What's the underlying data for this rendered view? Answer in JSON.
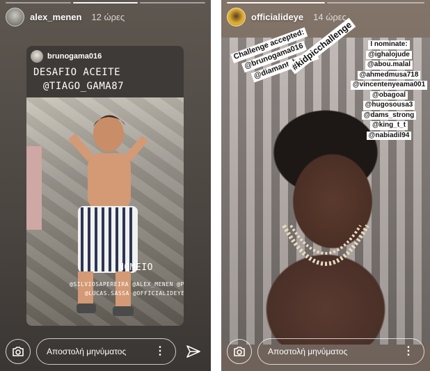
{
  "left": {
    "username": "alex_menen",
    "time": "12 ώρες",
    "reshare": {
      "username": "brunogama016",
      "title": "DESAFIO ACEITE",
      "tag": "@TIAGO_GAMA87",
      "nominate_label": "NOMEIO",
      "nominees_line1": "@SILVIOSAPEREIRA @ALEX_MENEN @PIZZI21",
      "nominees_line2": "@LUCAS.SASSA @OFFICIALIDEYE"
    },
    "message_placeholder": "Αποστολή μηνύματος",
    "more": "⋮",
    "send_icon": "send-icon"
  },
  "right": {
    "username": "officialideye",
    "time": "14 ώρες",
    "challenge_line1": "Challenge accepted:",
    "challenge_line2": "@brunogama016",
    "challenge_line3": "@diamant_barber",
    "hashtag": "#kidpicchallenge",
    "nominate_title": "I nominate:",
    "nominees": [
      "@ighalojude",
      "@abou.malal",
      "@ahmedmusa718",
      "@vincentenyeama001",
      "@obagoal",
      "@hugosousa3",
      "@dams_strong",
      "@king_t_t",
      "@nabiadil94"
    ],
    "message_placeholder": "Αποστολή μηνύματος",
    "more": "⋮"
  }
}
